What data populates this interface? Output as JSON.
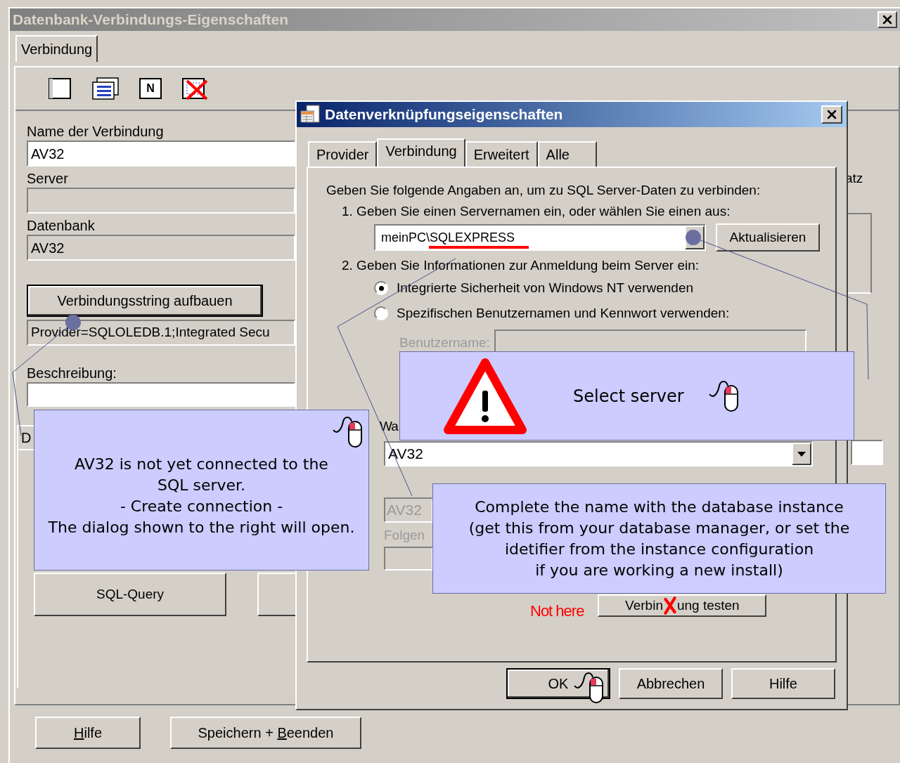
{
  "main_window": {
    "title": "Datenbank-Verbindungs-Eigenschaften",
    "tabs": [
      {
        "label": "Verbindung",
        "selected": true
      }
    ],
    "toolbar": [
      {
        "kind": "blank"
      },
      {
        "kind": "list"
      },
      {
        "kind": "labeled",
        "glyph": "N"
      },
      {
        "kind": "delete"
      }
    ],
    "fields": [
      {
        "label": "Name der Verbindung",
        "value": "AV32",
        "disabled": false
      },
      {
        "label": "Server",
        "disabled": true
      },
      {
        "label": "Datenbank",
        "value": "AV32",
        "disabled": true
      }
    ],
    "build_button": "Verbindungsstring aufbauen",
    "connection_string": "Provider=SQLOLEDB.1;Integrated Secu",
    "description_label": "Beschreibung:",
    "lower_tab": "D",
    "query_button": "SQL-Query",
    "side_label": "atz",
    "footer_buttons": [
      {
        "mnemonic": "H",
        "after": "ilfe"
      },
      {
        "before": "Speichern + ",
        "mnemonic": "B",
        "after": "eenden"
      }
    ]
  },
  "dialog": {
    "title": "Datenverknüpfungseigenschaften",
    "tabs": [
      {
        "label": "Provider",
        "selected": false
      },
      {
        "label": "Verbindung",
        "selected": true
      },
      {
        "label": "Erweitert",
        "selected": false
      },
      {
        "label": "Alle",
        "selected": false
      }
    ],
    "intro": "Geben Sie folgende Angaben an, um zu SQL Server-Daten zu verbinden:",
    "step1": "1. Geben Sie einen Servernamen ein, oder wählen Sie einen aus:",
    "server_value": "meinPC\\SQLEXPRESS",
    "refresh_button": "Aktualisieren",
    "step2": "2. Geben Sie Informationen zur Anmeldung beim Server ein:",
    "auth_options": [
      {
        "label": "Integrierte Sicherheit von Windows NT verwenden",
        "selected": true
      },
      {
        "label": "Spezifischen Benutzernamen und Kennwort verwenden:",
        "selected": false
      }
    ],
    "username_label": "Benutzername:",
    "db_option_fragment": "Wa",
    "database_value": "AV32",
    "file_value": "AV32",
    "file_label_fragment": "Folgen",
    "test_button": [
      "Verbin",
      "ung testen"
    ],
    "buttons": [
      {
        "label": "OK",
        "default": true
      },
      {
        "label": "Abbrechen",
        "default": false
      },
      {
        "label": "Hilfe",
        "default": false
      }
    ]
  },
  "annotations": [
    {
      "kind": "note",
      "lines": [
        "AV32 is not yet connected to the",
        "SQL server.",
        "- Create connection -",
        "The dialog shown to the right will open."
      ]
    },
    {
      "kind": "warning",
      "lines": [
        "Select server"
      ]
    },
    {
      "kind": "info",
      "lines": [
        "Complete the name with the database instance",
        "(get this from your database manager, or set the",
        "idetifier from the instance configuration",
        "if you are working a new install)"
      ]
    }
  ],
  "not_here": "Not here"
}
